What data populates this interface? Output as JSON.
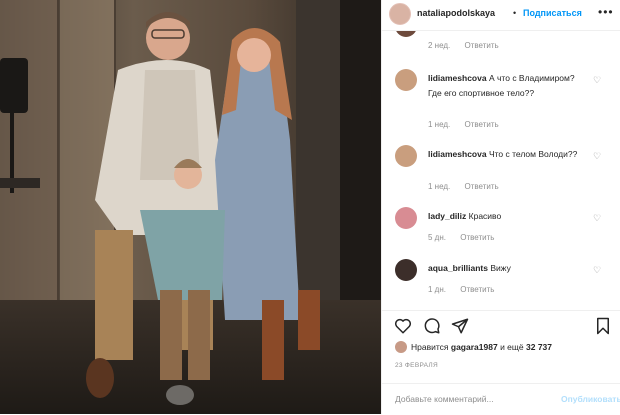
{
  "header": {
    "username": "nataliapodolskaya",
    "separator": "•",
    "follow_label": "Подписаться",
    "more": "•••"
  },
  "comments": [
    {
      "user": "",
      "text": "",
      "time": "2 нед.",
      "reply": "Ответить"
    },
    {
      "user": "lidiameshcova",
      "text": "А что с Владимиром? Где его спортивное тело??",
      "time": "1 нед.",
      "reply": "Ответить"
    },
    {
      "user": "lidiameshcova",
      "text": "Что с телом Володи??",
      "time": "1 нед.",
      "reply": "Ответить"
    },
    {
      "user": "lady_diliz",
      "text": "Красиво",
      "time": "5 дн.",
      "reply": "Ответить"
    },
    {
      "user": "aqua_brilliants",
      "text": "Вижу",
      "time": "1 дн.",
      "reply": "Ответить"
    }
  ],
  "likes": {
    "prefix": "Нравится",
    "user": "gagara1987",
    "mid": "и ещё",
    "count": "32 737"
  },
  "date": "23 ФЕВРАЛЯ",
  "add_comment": {
    "placeholder": "Добавьте комментарий...",
    "publish": "Опубликовать"
  },
  "colors": {
    "link": "#0095f6",
    "muted": "#8e8e8e",
    "text": "#262626",
    "publish_disabled": "#b2dffc"
  }
}
